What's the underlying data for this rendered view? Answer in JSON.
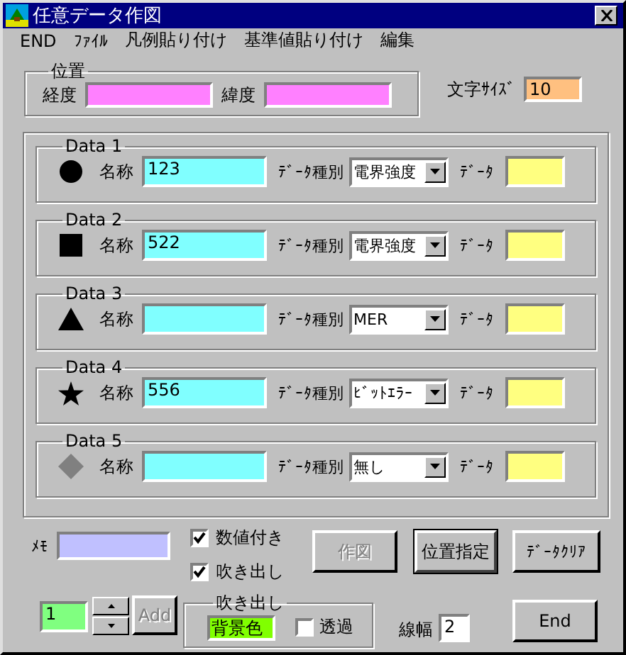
{
  "window": {
    "title": "任意データ作図"
  },
  "menu": [
    "END",
    "ﾌｧｲﾙ",
    "凡例貼り付け",
    "基準値貼り付け",
    "編集"
  ],
  "position": {
    "title": "位置",
    "fields": [
      {
        "label": "経度"
      },
      {
        "label": "緯度"
      }
    ]
  },
  "font_size": {
    "label": "文字ｻｲｽﾞ",
    "value": "10"
  },
  "data_groups": [
    {
      "title": "Data 1",
      "kind": "circle",
      "name_label": "名称",
      "name": "123",
      "type_label": "ﾃﾞｰﾀ種別",
      "type": "電界強度",
      "data_label": "ﾃﾞｰﾀ"
    },
    {
      "title": "Data 2",
      "kind": "square",
      "name_label": "名称",
      "name": "522",
      "type_label": "ﾃﾞｰﾀ種別",
      "type": "電界強度",
      "data_label": "ﾃﾞｰﾀ"
    },
    {
      "title": "Data 3",
      "kind": "triangle",
      "name_label": "名称",
      "type_label": "ﾃﾞｰﾀ種別",
      "type": "MER",
      "data_label": "ﾃﾞｰﾀ"
    },
    {
      "title": "Data 4",
      "kind": "star",
      "name_label": "名称",
      "name": "556",
      "type_label": "ﾃﾞｰﾀ種別",
      "type": "ﾋﾞｯﾄｴﾗｰ",
      "data_label": "ﾃﾞｰﾀ"
    },
    {
      "title": "Data 5",
      "kind": "diamond",
      "name_label": "名称",
      "type_label": "ﾃﾞｰﾀ種別",
      "type": "無し",
      "data_label": "ﾃﾞｰﾀ"
    }
  ],
  "memo": {
    "label": "ﾒﾓ"
  },
  "checkboxes": [
    {
      "label": "数値付き",
      "checked": true
    },
    {
      "label": "吹き出し",
      "checked": true
    }
  ],
  "buttons": [
    {
      "label": "作図",
      "disabled": true,
      "default": false
    },
    {
      "label": "位置指定",
      "disabled": false,
      "default": true
    },
    {
      "label": "ﾃﾞｰﾀｸﾘｱ",
      "disabled": false,
      "default": false
    }
  ],
  "counter": {
    "value": "1"
  },
  "add_button": {
    "label": "Add",
    "disabled": true
  },
  "balloon": {
    "title": "吹き出し",
    "background_label": "背景色",
    "transparent": {
      "label": "透過",
      "checked": false
    }
  },
  "line_width": {
    "label": "線幅",
    "value": "2"
  },
  "end_button": {
    "label": "End",
    "disabled": false
  }
}
